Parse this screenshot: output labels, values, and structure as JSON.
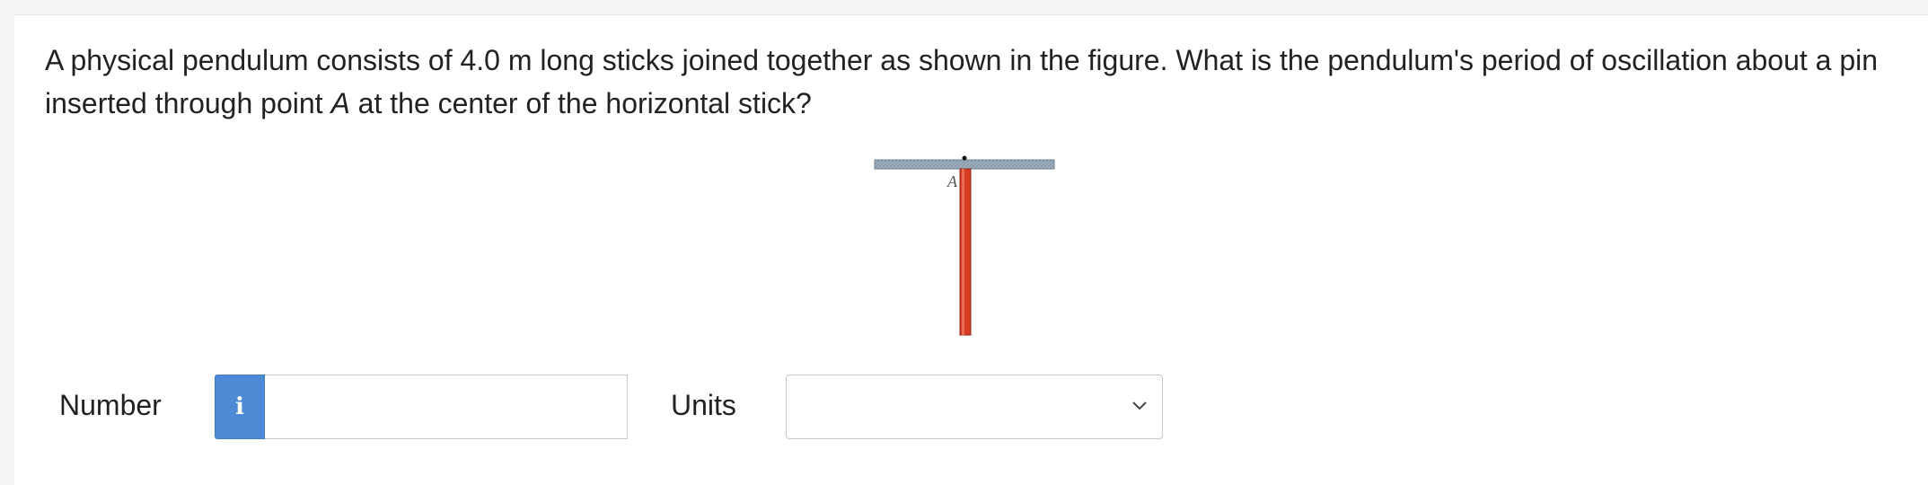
{
  "question": {
    "text_before": "A physical pendulum consists of 4.0 m long sticks joined together as shown in the figure. What is the pendulum's period of oscillation about a pin inserted through point ",
    "point_label": "A",
    "text_after": " at the center of the horizontal stick?"
  },
  "figure": {
    "point_label": "A",
    "horizontal_stick_color": "#8fa3b3",
    "vertical_stick_color": "#d93a22"
  },
  "answer": {
    "number_label": "Number",
    "info_icon": "i",
    "number_value": "",
    "units_label": "Units",
    "units_value": ""
  },
  "colors": {
    "accent": "#4d8ad6"
  }
}
